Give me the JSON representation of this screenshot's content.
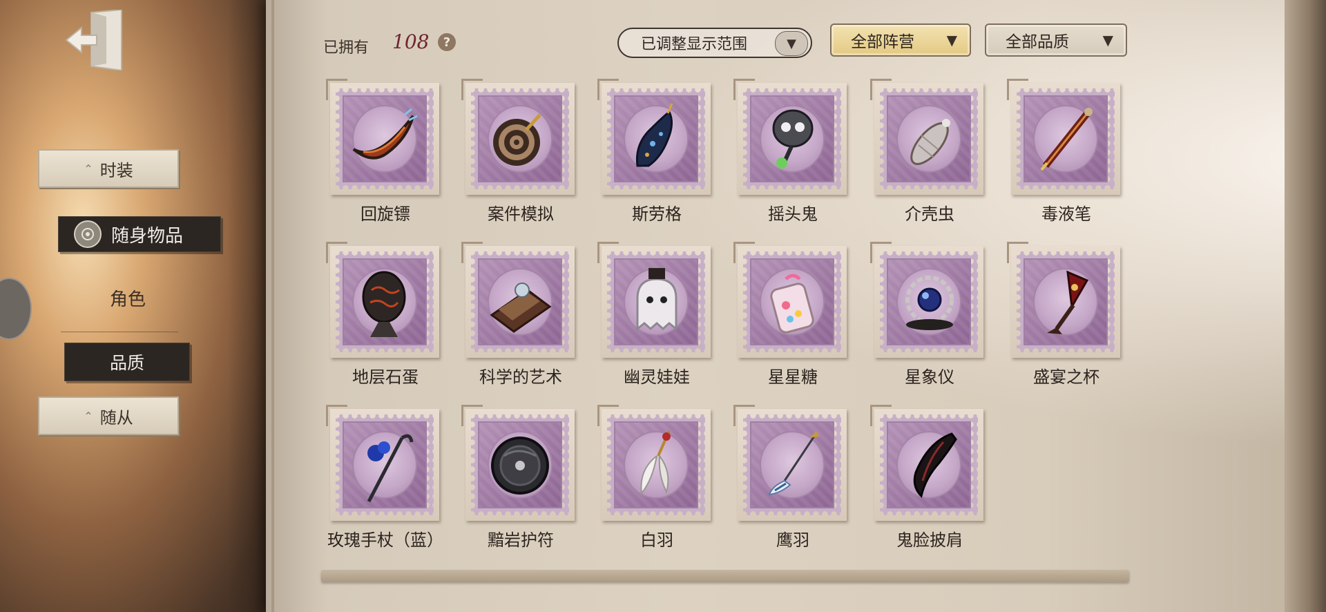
{
  "header": {
    "owned_label": "已拥有",
    "owned_count": "108",
    "help": "?",
    "range_dropdown": "已调整显示范围",
    "camp_filter": "全部阵营",
    "quality_filter": "全部品质"
  },
  "sidebar": {
    "fashion": "时装",
    "accessory": "随身物品",
    "role": "角色",
    "quality": "品质",
    "follower": "随从"
  },
  "items": [
    {
      "name": "回旋镖",
      "icon": "boomerang-icon"
    },
    {
      "name": "案件模拟",
      "icon": "target-dart-icon"
    },
    {
      "name": "斯劳格",
      "icon": "slug-icon"
    },
    {
      "name": "摇头鬼",
      "icon": "bobblehead-ghost-icon"
    },
    {
      "name": "介壳虫",
      "icon": "scale-insect-icon"
    },
    {
      "name": "毒液笔",
      "icon": "venom-pen-icon"
    },
    {
      "name": "地层石蛋",
      "icon": "stone-egg-icon"
    },
    {
      "name": "科学的艺术",
      "icon": "science-book-icon"
    },
    {
      "name": "幽灵娃娃",
      "icon": "ghost-doll-icon"
    },
    {
      "name": "星星糖",
      "icon": "star-candy-jar-icon"
    },
    {
      "name": "星象仪",
      "icon": "planetarium-icon"
    },
    {
      "name": "盛宴之杯",
      "icon": "feast-cup-icon"
    },
    {
      "name": "玫瑰手杖（蓝）",
      "icon": "rose-cane-icon"
    },
    {
      "name": "黯岩护符",
      "icon": "dark-rock-amulet-icon"
    },
    {
      "name": "白羽",
      "icon": "white-feather-icon"
    },
    {
      "name": "鹰羽",
      "icon": "eagle-feather-icon"
    },
    {
      "name": "鬼脸披肩",
      "icon": "ghost-shawl-icon"
    }
  ],
  "colors": {
    "stamp_purple": "#a686aa",
    "count_red": "#6e2630",
    "camp_gold": "#e3c985"
  }
}
